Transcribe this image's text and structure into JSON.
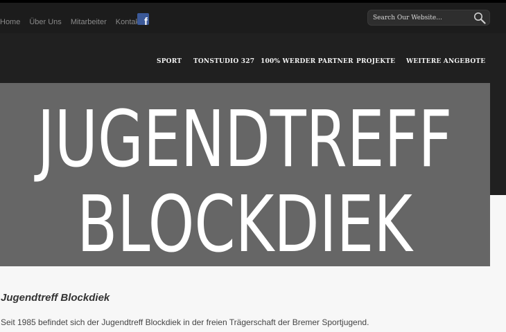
{
  "top_nav": {
    "items": [
      {
        "label": "Home"
      },
      {
        "label": "Über Uns"
      },
      {
        "label": "Mitarbeiter"
      },
      {
        "label": "Kontakt"
      }
    ],
    "facebook_icon": "facebook-icon"
  },
  "search": {
    "placeholder": "Search Our Website...",
    "icon": "search-icon"
  },
  "main_nav": {
    "items": [
      {
        "label": "SPORT"
      },
      {
        "label": "TONSTUDIO 327"
      },
      {
        "label": "100% WERDER PARTNER"
      },
      {
        "label": "PROJEKTE"
      },
      {
        "label": "WEITERE ANGEBOTE"
      }
    ]
  },
  "hero": {
    "line1": "JUGENDTREFF",
    "line2": "BLOCKDIEK",
    "background": "#666666",
    "text_color": "#ffffff"
  },
  "content": {
    "title": "Jugendtreff Blockdiek",
    "text": "Seit 1985 befindet sich der Jugendtreff Blockdiek in der freien Trägerschaft der Bremer Sportjugend."
  }
}
